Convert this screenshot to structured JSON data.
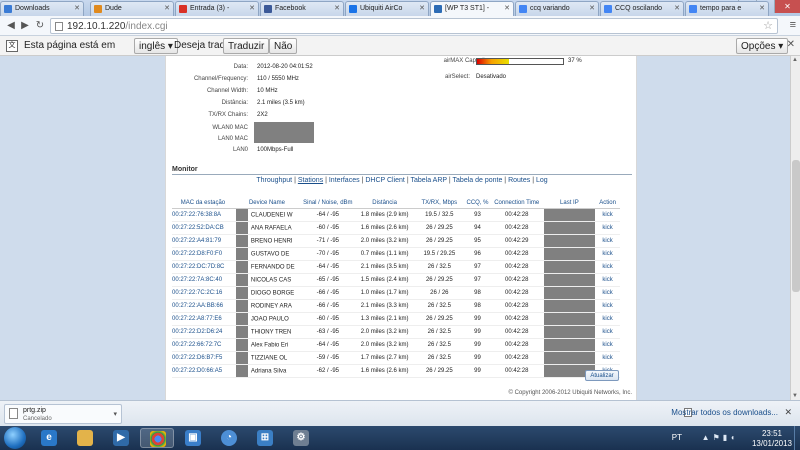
{
  "browser": {
    "tabs": [
      {
        "label": "Downloads",
        "color": "#3a7bd5"
      },
      {
        "label": "Dude",
        "color": "#e08a1e"
      },
      {
        "label": "Entrada (3) -",
        "color": "#d93025"
      },
      {
        "label": "Facebook",
        "color": "#3b5998"
      },
      {
        "label": "Ubiquiti AirCo",
        "color": "#1a73e8"
      },
      {
        "label": "[WP T3 ST1] -",
        "color": "#2d6cb5"
      },
      {
        "label": "ccq variando",
        "color": "#4285f4"
      },
      {
        "label": "CCQ oscilando",
        "color": "#4285f4"
      },
      {
        "label": "tempo para e",
        "color": "#4285f4"
      }
    ],
    "url_host": "192.10.1.220",
    "url_path": "/index.cgi",
    "window_buttons": {
      "minimize": "–",
      "maximize": "□",
      "close": "✕"
    }
  },
  "translate_bar": {
    "prefix": "Esta página está em",
    "language": "inglês",
    "question": "Deseja traduzi-la?",
    "translate_button": "Traduzir",
    "no_button": "Não",
    "options_button": "Opções",
    "close": "✕"
  },
  "device_info": {
    "rows": [
      {
        "label": "Data:",
        "value": "2012-08-20 04:01:52"
      },
      {
        "label": "Channel/Frequency:",
        "value": "110 / 5550 MHz"
      },
      {
        "label": "Channel Width:",
        "value": "10 MHz"
      },
      {
        "label": "Distância:",
        "value": "2.1 miles (3.5 km)"
      },
      {
        "label": "TX/RX Chains:",
        "value": "2X2"
      },
      {
        "label": "WLAN0 MAC",
        "value": ""
      },
      {
        "label": "LAN0 MAC",
        "value": ""
      },
      {
        "label": "LAN0",
        "value": "100Mbps-Full"
      }
    ],
    "airmax_label": "airMAX Capacity:",
    "airmax_percent_text": "37 %",
    "airmax_fraction": 0.37,
    "airselect_label": "airSelect:",
    "airselect_value": "Desativado"
  },
  "monitor": {
    "title": "Monitor",
    "links": [
      "Throughput",
      "Stations",
      "Interfaces",
      "DHCP Client",
      "Tabela ARP",
      "Tabela de ponte",
      "Routes",
      "Log"
    ],
    "selected_link": "Stations",
    "columns": [
      "MAC da estação",
      "Device Name",
      "Sinal / Noise, dBm",
      "Distância",
      "TX/RX, Mbps",
      "CCQ, %",
      "Connection Time",
      "Last IP",
      "Action"
    ],
    "stations": [
      {
        "mac": "00:27:22:76:38:8A",
        "name": "CLAUDENEI W",
        "signal": "-64 / -95",
        "distance": "1.8 miles (2.9 km)",
        "txrx": "19.5 / 32.5",
        "ccq": "93",
        "time": "00:42:28",
        "action": "kick"
      },
      {
        "mac": "00:27:22:52:DA:CB",
        "name": "ANA RAFAELA",
        "signal": "-60 / -95",
        "distance": "1.6 miles (2.6 km)",
        "txrx": "26 / 29.25",
        "ccq": "94",
        "time": "00:42:28",
        "action": "kick"
      },
      {
        "mac": "00:27:22:A4:81:79",
        "name": "BRENO HENRI",
        "signal": "-71 / -95",
        "distance": "2.0 miles (3.2 km)",
        "txrx": "26 / 29.25",
        "ccq": "95",
        "time": "00:42:29",
        "action": "kick"
      },
      {
        "mac": "00:27:22:D8:F0:F0",
        "name": "GUSTAVO DE",
        "signal": "-70 / -95",
        "distance": "0.7 miles (1.1 km)",
        "txrx": "19.5 / 29.25",
        "ccq": "96",
        "time": "00:42:28",
        "action": "kick"
      },
      {
        "mac": "00:27:22:DC:7D:8C",
        "name": "FERNANDO DE",
        "signal": "-64 / -95",
        "distance": "2.1 miles (3.5 km)",
        "txrx": "26 / 32.5",
        "ccq": "97",
        "time": "00:42:28",
        "action": "kick"
      },
      {
        "mac": "00:27:22:7A:8C:40",
        "name": "NICOLAS CAS",
        "signal": "-65 / -95",
        "distance": "1.5 miles (2.4 km)",
        "txrx": "26 / 29.25",
        "ccq": "97",
        "time": "00:42:28",
        "action": "kick"
      },
      {
        "mac": "00:27:22:7C:2C:16",
        "name": "DIOGO BORGE",
        "signal": "-66 / -95",
        "distance": "1.0 miles (1.7 km)",
        "txrx": "26 / 26",
        "ccq": "98",
        "time": "00:42:28",
        "action": "kick"
      },
      {
        "mac": "00:27:22:AA:BB:66",
        "name": "RODINEY ARA",
        "signal": "-66 / -95",
        "distance": "2.1 miles (3.3 km)",
        "txrx": "26 / 32.5",
        "ccq": "98",
        "time": "00:42:28",
        "action": "kick"
      },
      {
        "mac": "00:27:22:A8:77:E6",
        "name": "JOAO PAULO",
        "signal": "-60 / -95",
        "distance": "1.3 miles (2.1 km)",
        "txrx": "26 / 29.25",
        "ccq": "99",
        "time": "00:42:28",
        "action": "kick"
      },
      {
        "mac": "00:27:22:D2:D6:24",
        "name": "THIONY TREN",
        "signal": "-63 / -95",
        "distance": "2.0 miles (3.2 km)",
        "txrx": "26 / 32.5",
        "ccq": "99",
        "time": "00:42:28",
        "action": "kick"
      },
      {
        "mac": "00:27:22:66:72:7C",
        "name": "Alex Fabio Eri",
        "signal": "-64 / -95",
        "distance": "2.0 miles (3.2 km)",
        "txrx": "26 / 32.5",
        "ccq": "99",
        "time": "00:42:28",
        "action": "kick"
      },
      {
        "mac": "00:27:22:D6:B7:F5",
        "name": "TIZZIANE OL",
        "signal": "-59 / -95",
        "distance": "1.7 miles (2.7 km)",
        "txrx": "26 / 32.5",
        "ccq": "99",
        "time": "00:42:28",
        "action": "kick"
      },
      {
        "mac": "00:27:22:D0:66:A5",
        "name": "Adriana Silva",
        "signal": "-62 / -95",
        "distance": "1.6 miles (2.6 km)",
        "txrx": "26 / 29.25",
        "ccq": "99",
        "time": "00:42:28",
        "action": "kick"
      }
    ],
    "update_button": "Atualizar"
  },
  "copyright": "© Copyright 2006-2012 Ubiquiti Networks, Inc.",
  "downloads": {
    "file_name": "prtg.zip",
    "file_status": "Cancelado",
    "show_all": "Mostrar todos os downloads...",
    "close": "✕"
  },
  "taskbar": {
    "language": "PT",
    "time": "23:51",
    "date": "13/01/2013"
  }
}
